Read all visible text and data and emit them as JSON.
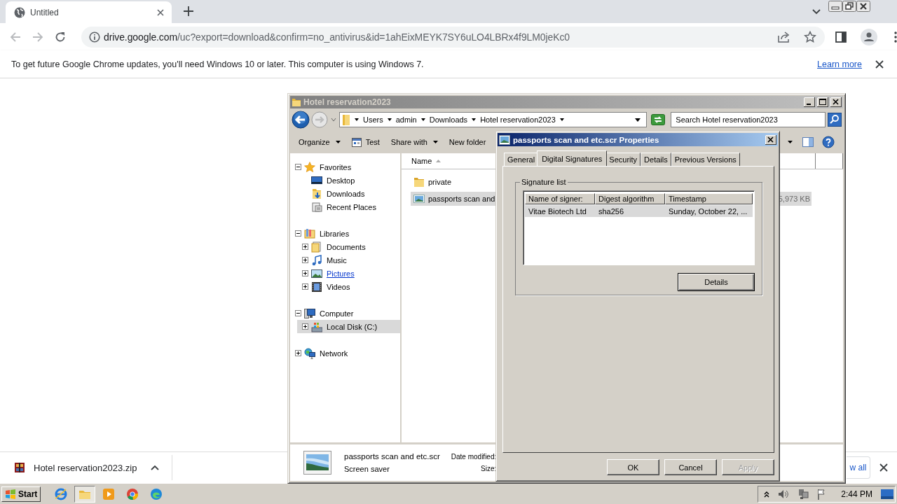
{
  "browser": {
    "tab": {
      "title": "Untitled",
      "selected": true
    },
    "back": {
      "disabled": true
    },
    "forward": {
      "disabled": true
    },
    "address": {
      "host": "drive.google.com",
      "path": "/uc?export=download&confirm=no_antivirus&id=1ahEixMEYK7SY6uLO4LBRx4f9LM0jeKc0"
    },
    "infobar": {
      "message": "To get future Google Chrome updates, you'll need Windows 10 or later. This computer is using Windows 7.",
      "link": "Learn more"
    },
    "downloads": {
      "file": "Hotel reservation2023.zip",
      "show_all": "w all"
    }
  },
  "explorer": {
    "title": "Hotel reservation2023",
    "breadcrumbs": [
      "Users",
      "admin",
      "Downloads",
      "Hotel reservation2023"
    ],
    "search": {
      "placeholder": "Search Hotel reservation2023"
    },
    "toolbar": [
      {
        "label": "Organize",
        "kind": "menu"
      },
      {
        "label": "Test",
        "kind": "icon"
      },
      {
        "label": "Share with",
        "kind": "menu"
      },
      {
        "label": "New folder",
        "kind": "plain"
      }
    ],
    "tree": [
      {
        "label": "Favorites",
        "kind": "star",
        "expanded": true,
        "selected": false,
        "hovered": false,
        "children": [
          {
            "label": "Desktop",
            "kind": "desktop",
            "selected": false,
            "hovered": false
          },
          {
            "label": "Downloads",
            "kind": "downloads",
            "selected": false,
            "hovered": false
          },
          {
            "label": "Recent Places",
            "kind": "recent",
            "selected": false,
            "hovered": false
          }
        ]
      },
      {
        "label": "Libraries",
        "kind": "library",
        "expanded": true,
        "selected": false,
        "hovered": false,
        "children": [
          {
            "label": "Documents",
            "kind": "documents",
            "expanded": false,
            "selected": false,
            "hovered": false
          },
          {
            "label": "Music",
            "kind": "music",
            "expanded": false,
            "selected": false,
            "hovered": false
          },
          {
            "label": "Pictures",
            "kind": "pictures",
            "expanded": false,
            "selected": false,
            "hovered": true
          },
          {
            "label": "Videos",
            "kind": "videos",
            "expanded": false,
            "selected": false,
            "hovered": false
          }
        ]
      },
      {
        "label": "Computer",
        "kind": "computer",
        "expanded": true,
        "selected": false,
        "hovered": false,
        "children": [
          {
            "label": "Local Disk (C:)",
            "kind": "disk",
            "expanded": false,
            "selected": true,
            "hovered": false
          }
        ]
      },
      {
        "label": "Network",
        "kind": "network",
        "expanded": false,
        "selected": false,
        "hovered": false
      }
    ],
    "columns": [
      {
        "label": "Name",
        "sorted": true
      }
    ],
    "files": [
      {
        "name": "private",
        "kind": "folder",
        "selected": false
      },
      {
        "name": "passports scan and",
        "kind": "screensaver",
        "selected": true,
        "size": "5,973 KB"
      }
    ],
    "details": {
      "name": "passports scan and etc.scr",
      "type": "Screen saver",
      "date_label": "Date modified:",
      "size_label": "Size:"
    }
  },
  "dialog": {
    "title": "passports scan and etc.scr Properties",
    "tabs": [
      {
        "label": "General",
        "selected": false
      },
      {
        "label": "Digital Signatures",
        "selected": true
      },
      {
        "label": "Security",
        "selected": false
      },
      {
        "label": "Details",
        "selected": false
      },
      {
        "label": "Previous Versions",
        "selected": false
      }
    ],
    "group": "Signature list",
    "columns": [
      "Name of signer:",
      "Digest algorithm",
      "Timestamp"
    ],
    "rows": [
      {
        "cells": [
          "Vitae Biotech Ltd",
          "sha256",
          "Sunday, October 22, ..."
        ],
        "selected": true
      }
    ],
    "details_button": "Details",
    "buttons": [
      {
        "label": "OK",
        "disabled": false
      },
      {
        "label": "Cancel",
        "disabled": false
      },
      {
        "label": "Apply",
        "disabled": true
      }
    ]
  },
  "taskbar": {
    "start": "Start",
    "apps": [
      {
        "kind": "ie",
        "active": false
      },
      {
        "kind": "explorer",
        "active": true
      },
      {
        "kind": "media",
        "active": false
      },
      {
        "kind": "chrome",
        "active": false
      },
      {
        "kind": "edge",
        "active": false
      }
    ],
    "clock": "2:44 PM"
  }
}
